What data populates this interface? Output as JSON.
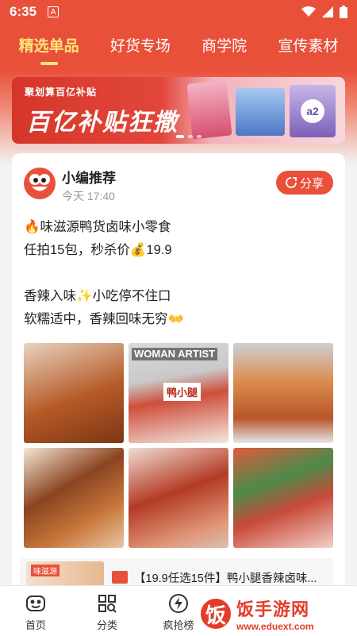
{
  "status_bar": {
    "time": "6:35",
    "notification_badge": "A"
  },
  "tabs": [
    {
      "label": "精选单品",
      "active": true
    },
    {
      "label": "好货专场",
      "active": false
    },
    {
      "label": "商学院",
      "active": false
    },
    {
      "label": "宣传素材",
      "active": false
    }
  ],
  "banner": {
    "small_text": "聚划算百亿补贴",
    "headline": "百亿补贴狂撒",
    "product_badge": "a2"
  },
  "post": {
    "author": "小编推荐",
    "time": "今天 17:40",
    "share_label": "分享",
    "lines": [
      "🔥味滋源鸭货卤味小零食",
      "任拍15包，秒杀价💰19.9",
      "",
      "香辣入味✨小吃停不住口",
      "软糯适中，香辣回味无穷👐"
    ],
    "image_labels": [
      "鸭小腿",
      "WOMAN ARTIST"
    ]
  },
  "product": {
    "thumb_tag": "味滋源",
    "title": "【19.9任选15件】鸭小腿香辣卤味..."
  },
  "bottom_nav": [
    {
      "label": "首页",
      "icon": "home-face-icon"
    },
    {
      "label": "分类",
      "icon": "category-grid-icon"
    },
    {
      "label": "疯抢榜",
      "icon": "lightning-icon"
    }
  ],
  "watermark": {
    "logo_char": "饭",
    "title": "饭手游网",
    "url": "www.eduext.com"
  },
  "colors": {
    "brand": "#e8503a",
    "active_tab": "#ffe27a"
  }
}
